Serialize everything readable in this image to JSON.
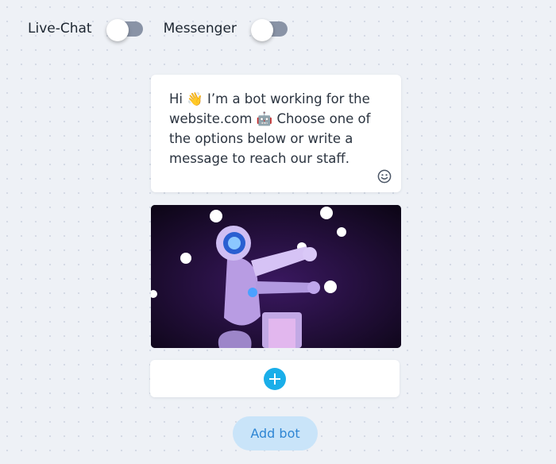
{
  "toggles": [
    {
      "label": "Live-Chat",
      "enabled": false
    },
    {
      "label": "Messenger",
      "enabled": false
    }
  ],
  "message": {
    "text": "Hi 👋  I’m a bot working for the website.com 🤖  Choose one of the options below or write a message to reach our staff.",
    "emoji_button_icon": "smiley-icon"
  },
  "media": {
    "icon": "robot-animation-image"
  },
  "add_block": {
    "icon": "plus-icon"
  },
  "add_bot_label": "Add bot"
}
